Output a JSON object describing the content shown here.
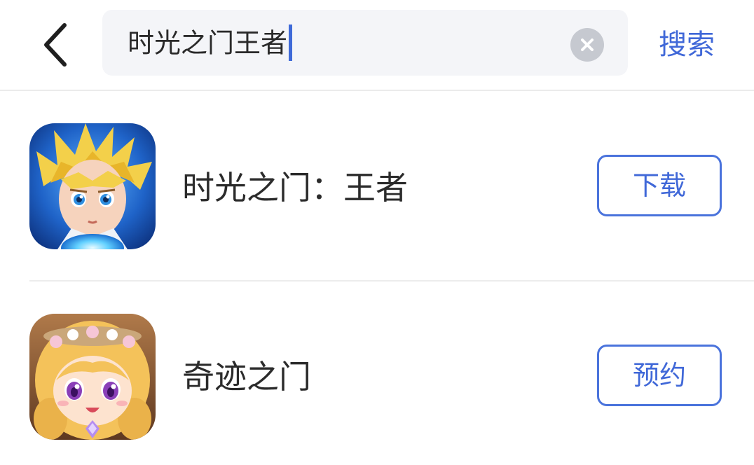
{
  "search": {
    "query": "时光之门王者",
    "submit_label": "搜索"
  },
  "results": [
    {
      "name": "时光之门：王者",
      "action_label": "下载",
      "icon": "blonde-hero-game-icon"
    },
    {
      "name": "奇迹之门",
      "action_label": "预约",
      "icon": "chibi-girl-game-icon"
    }
  ],
  "colors": {
    "accent": "#4068d8",
    "search_bg": "#f4f5f8",
    "clear_icon": "#c6c9d0",
    "divider": "#ebebeb"
  }
}
